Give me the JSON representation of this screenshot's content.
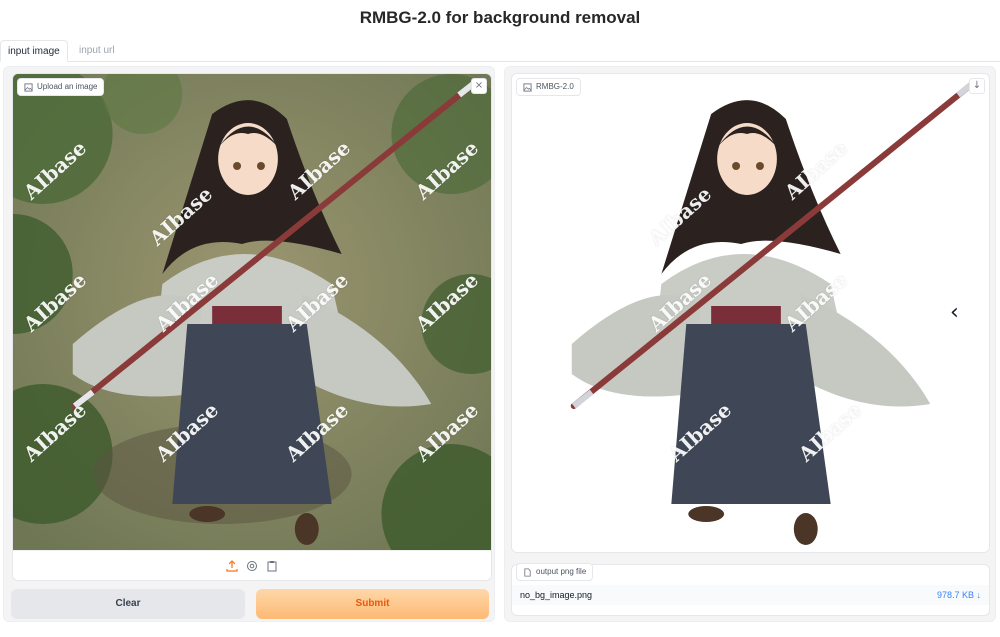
{
  "title": "RMBG-2.0 for background removal",
  "tabs": [
    {
      "label": "input image",
      "active": true
    },
    {
      "label": "input url",
      "active": false
    }
  ],
  "input_panel": {
    "label": "Upload an image",
    "close_icon": "close-icon",
    "toolbar_icons": [
      "upload-icon",
      "webcam-icon",
      "clipboard-icon"
    ]
  },
  "output_panel": {
    "label": "RMBG-2.0",
    "download_icon": "download-icon"
  },
  "file_panel": {
    "label": "output png file",
    "file_name": "no_bg_image.png",
    "file_size": "978.7 KB ↓"
  },
  "buttons": {
    "clear": "Clear",
    "submit": "Submit"
  },
  "watermark": "AIbase",
  "nav": {
    "icon": "chevron-left-icon",
    "glyph": "‹"
  },
  "colors": {
    "accent": "#ea580c",
    "submit_bg": "#fdba74",
    "link": "#3b82f6"
  }
}
